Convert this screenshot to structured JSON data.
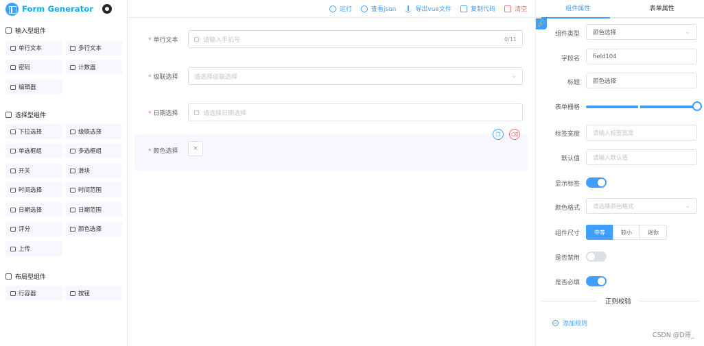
{
  "app": {
    "title": "Form Generator"
  },
  "toolbar": {
    "run": "运行",
    "view_json": "查看json",
    "export_vue": "导出vue文件",
    "copy_code": "复制代码",
    "clear": "清空"
  },
  "left": {
    "categories": [
      {
        "title": "输入型组件",
        "items": [
          "单行文本",
          "多行文本",
          "密码",
          "计数器",
          "编辑器"
        ]
      },
      {
        "title": "选择型组件",
        "items": [
          "下拉选择",
          "级联选择",
          "单选框组",
          "多选框组",
          "开关",
          "滑块",
          "时间选择",
          "时间范围",
          "日期选择",
          "日期范围",
          "评分",
          "颜色选择",
          "上传"
        ]
      },
      {
        "title": "布局型组件",
        "items": [
          "行容器",
          "按钮"
        ]
      }
    ]
  },
  "center": {
    "fields": [
      {
        "label": "单行文本",
        "placeholder": "请输入手机号",
        "count": "0/11"
      },
      {
        "label": "级联选择",
        "placeholder": "请选择级联选择",
        "arrow": "⌄"
      },
      {
        "label": "日期选择",
        "placeholder": "请选择日期选择"
      },
      {
        "label": "颜色选择",
        "clear": "×"
      }
    ],
    "required_mark": "*"
  },
  "right": {
    "tabs": [
      "组件属性",
      "表单属性"
    ],
    "props": {
      "component_type": {
        "label": "组件类型",
        "value": "颜色选择"
      },
      "field_name": {
        "label": "字段名",
        "value": "field104"
      },
      "title": {
        "label": "标题",
        "value": "颜色选择"
      },
      "grid": {
        "label": "表单栅格",
        "value": 1.0
      },
      "label_width": {
        "label": "标签宽度",
        "placeholder": "请输入标签宽度"
      },
      "default_value": {
        "label": "默认值",
        "placeholder": "请输入默认值"
      },
      "show_label": {
        "label": "显示标签",
        "on": true
      },
      "color_format": {
        "label": "颜色格式",
        "placeholder": "请选择颜色格式"
      },
      "size": {
        "label": "组件尺寸",
        "options": [
          "中等",
          "较小",
          "迷你"
        ],
        "selected": "中等"
      },
      "disabled": {
        "label": "是否禁用",
        "on": false
      },
      "required": {
        "label": "是否必填",
        "on": true
      }
    },
    "regex_title": "正则校验",
    "add_rule": "添加规则"
  },
  "watermark": "CSDN @D哥_",
  "colors": {
    "primary": "#409eff",
    "danger": "#f56c6c",
    "logo": "#00afff",
    "item_bg": "#f6f7ff"
  }
}
